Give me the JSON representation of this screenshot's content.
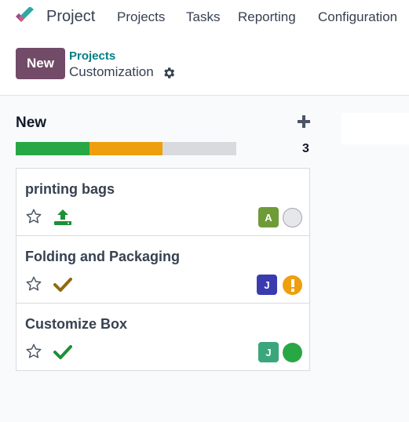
{
  "topbar": {
    "app_name": "Project",
    "nav": [
      "Projects",
      "Tasks",
      "Reporting",
      "Configuration"
    ]
  },
  "control": {
    "new_label": "New",
    "breadcrumb_parent": "Projects",
    "breadcrumb_current": "Customization"
  },
  "column": {
    "title": "New",
    "count": "3",
    "progress": [
      {
        "name": "on-track",
        "fraction": 0.333,
        "color": "#28a745"
      },
      {
        "name": "at-risk",
        "fraction": 0.333,
        "color": "#ee9f0d"
      }
    ]
  },
  "cards": [
    {
      "title": "printing bags",
      "status_icon": "upload-icon",
      "avatar": "A",
      "avatar_color": "#6f9a38",
      "state": "normal-state"
    },
    {
      "title": "Folding and Packaging",
      "status_icon": "check-icon",
      "avatar": "J",
      "avatar_color": "#3b3bb0",
      "state": "blocked-state"
    },
    {
      "title": "Customize Box",
      "status_icon": "check-icon",
      "avatar": "J",
      "avatar_color": "#3aa67c",
      "state": "done-state"
    }
  ],
  "colors": {
    "brand": "#714b67",
    "link": "#017e84",
    "state_normal": "#e5e7eb",
    "state_blocked": "#ee9f0d",
    "state_done": "#28a745",
    "check_brown": "#8f6a0f",
    "check_green": "#1d8f36"
  }
}
